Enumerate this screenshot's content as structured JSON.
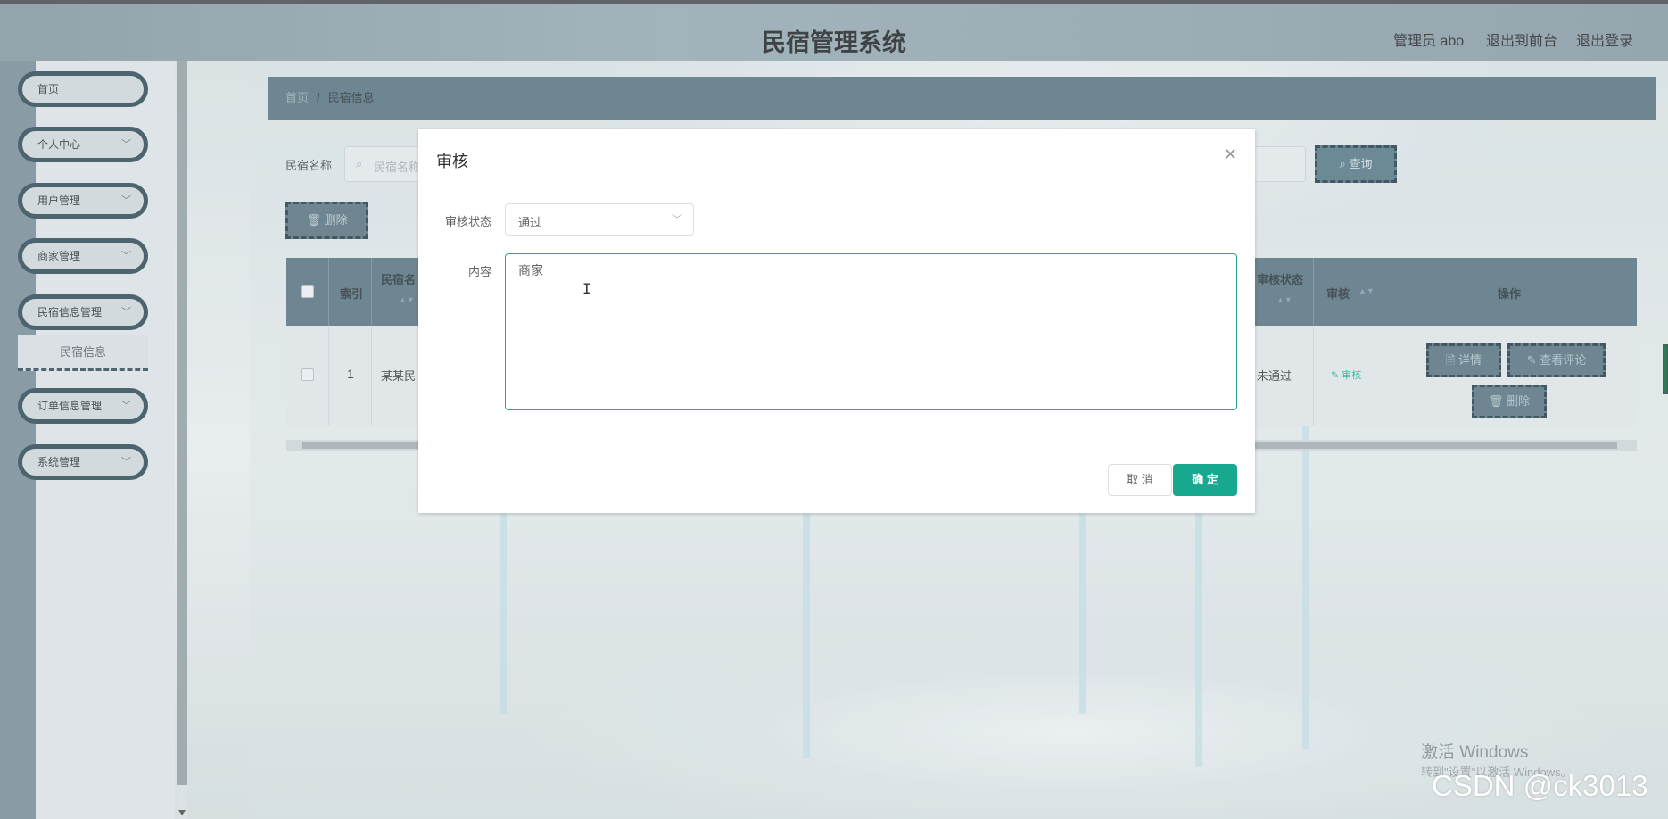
{
  "header": {
    "title": "民宿管理系统",
    "admin_label": "管理员 abo",
    "exit_front": "退出到前台",
    "logout": "退出登录"
  },
  "sidebar": {
    "items": [
      {
        "label": "首页"
      },
      {
        "label": "个人中心"
      },
      {
        "label": "用户管理"
      },
      {
        "label": "商家管理"
      },
      {
        "label": "民宿信息管理"
      },
      {
        "label": "订单信息管理"
      },
      {
        "label": "系统管理"
      }
    ],
    "sub_item": "民宿信息"
  },
  "breadcrumb": {
    "home": "首页",
    "separator": "/",
    "current": "民宿信息"
  },
  "search": {
    "label": "民宿名称",
    "placeholder": "民宿名称",
    "query_button": "查询",
    "delete_button": "删除"
  },
  "table": {
    "headers": {
      "index": "索引",
      "name": "民宿名",
      "audit_status": "审核状态",
      "audit": "审核",
      "actions": "操作"
    },
    "rows": [
      {
        "index": "1",
        "name": "某某民",
        "audit_status": "未通过",
        "audit_link": "审核",
        "btn_detail": "详情",
        "btn_comments": "查看评论",
        "btn_delete": "删除"
      }
    ]
  },
  "modal": {
    "title": "审核",
    "status_label": "审核状态",
    "status_value": "通过",
    "content_label": "内容",
    "content_value": "商家",
    "cancel": "取 消",
    "confirm": "确 定"
  },
  "watermarks": {
    "windows_line1": "激活 Windows",
    "windows_line2": "转到\"设置\"以激活 Windows。",
    "csdn": "CSDN @ck3013"
  },
  "colors": {
    "accent": "#17a88f",
    "sidebar_dark": "#24424f",
    "table_header": "#4f6c7a"
  }
}
